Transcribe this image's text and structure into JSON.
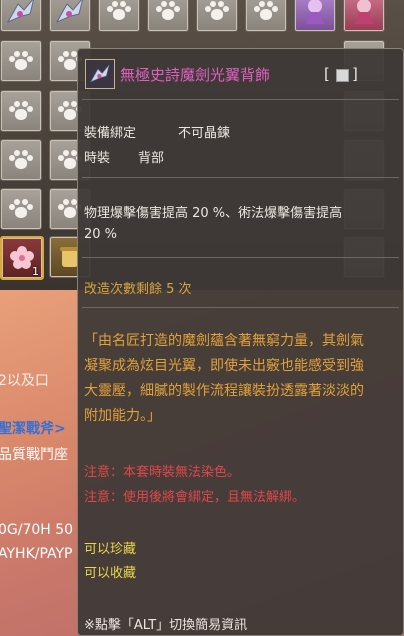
{
  "tooltip": {
    "title": "無極史詩魔劍光翼背飾",
    "title_bracket_open": "[",
    "title_bracket_close": "]",
    "bind": "裝備綁定",
    "crystal": "不可晶鍊",
    "type_label": "時裝",
    "type_value": "背部",
    "effect_line1": "物理爆擊傷害提高 20 %、術法爆擊傷害提高",
    "effect_line2": "20 %",
    "modify": "改造次數剩餘 5 次",
    "desc_line1": "「由名匠打造的魔劍蘊含著無窮力量，其劍氣",
    "desc_line2": "凝聚成為炫目光翼，即使未出竅也能感受到強",
    "desc_line3": "大靈壓，細膩的製作流程讓裝扮透露著淡淡的",
    "desc_line4": "附加能力。」",
    "note1": "注意：本套時裝無法染色。",
    "note2": "注意：使用後將會綁定，且無法解綁。",
    "treasure": "可以珍藏",
    "collect": "可以收藏",
    "hint": "※點擊「ALT」切換簡易資訊"
  },
  "inventory": {
    "flower_qty": "1"
  },
  "stream": {
    "line1": "2以及口",
    "line2": "聖潔戰斧>",
    "line3": "品質戰鬥座",
    "line4": "0G/70H 50",
    "line5": "AYHK/PAYP"
  },
  "colors": {
    "item_name": "#e060c0",
    "modify_text": "#d9a441",
    "warning": "#e04848",
    "storage": "#e8d84a"
  }
}
